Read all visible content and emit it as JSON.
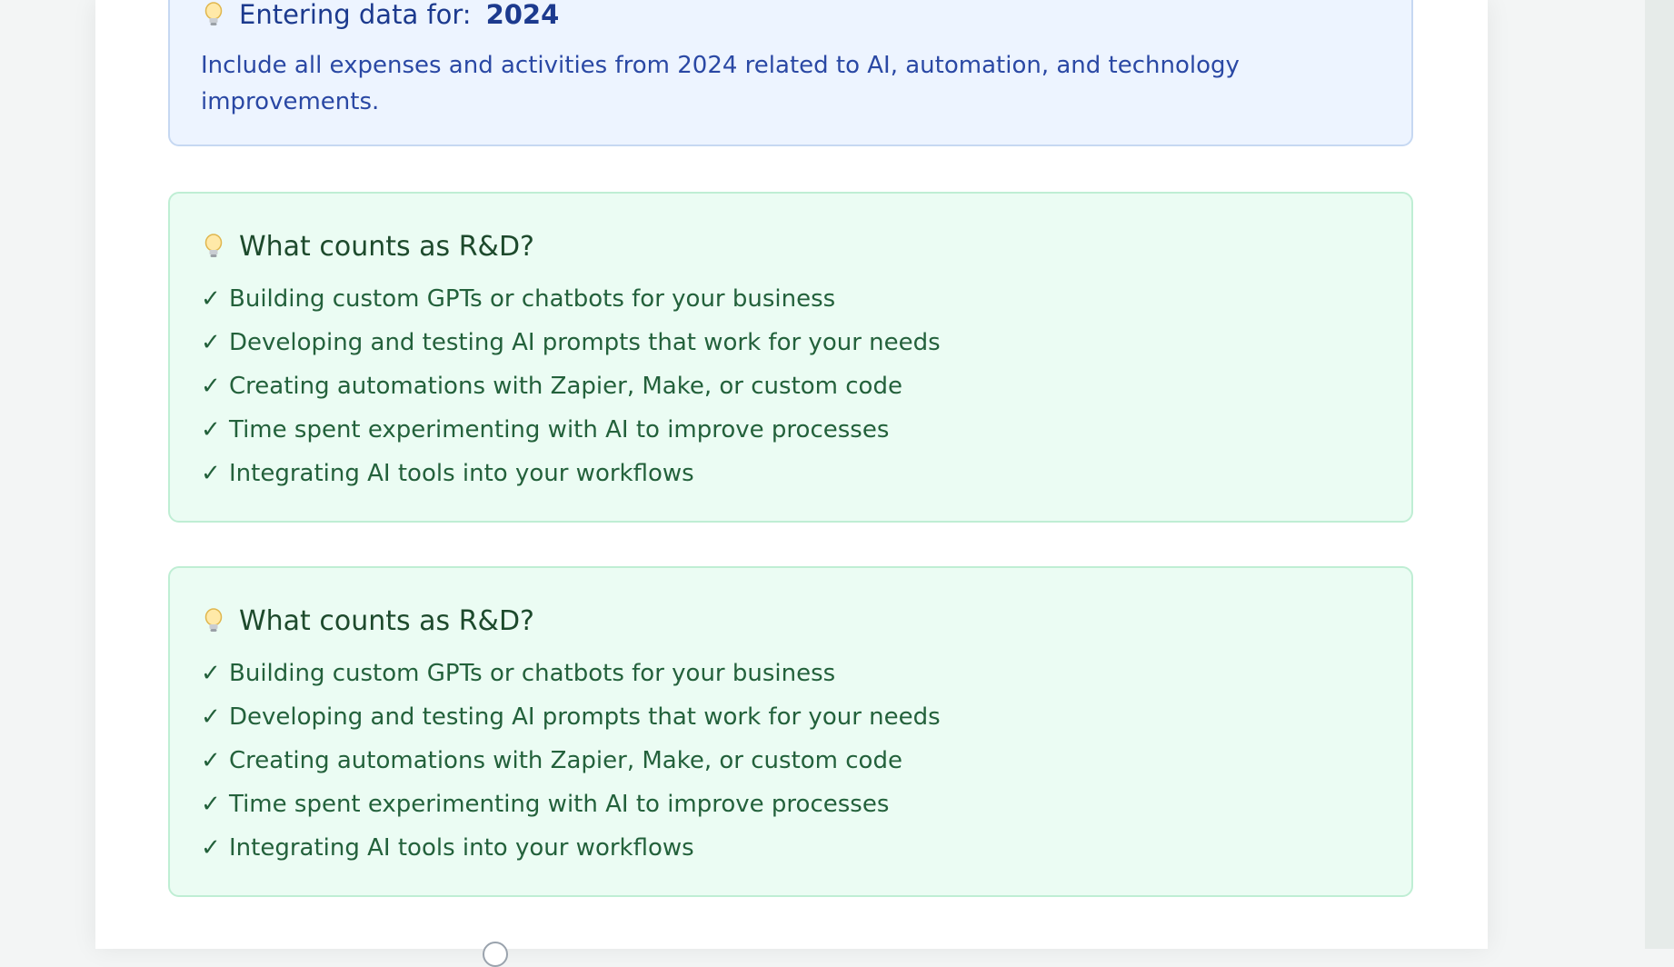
{
  "info": {
    "label": "Entering data for:",
    "year": "2024",
    "text": "Include all expenses and activities from 2024 related to AI, automation, and technology improvements.",
    "icon": "lightbulb-icon"
  },
  "rd_sections": [
    {
      "title": "What counts as R&D?",
      "icon": "lightbulb-icon",
      "items": [
        "Building custom GPTs or chatbots for your business",
        "Developing and testing AI prompts that work for your needs",
        "Creating automations with Zapier, Make, or custom code",
        "Time spent experimenting with AI to improve processes",
        "Integrating AI tools into your workflows"
      ]
    },
    {
      "title": "What counts as R&D?",
      "icon": "lightbulb-icon",
      "items": [
        "Building custom GPTs or chatbots for your business",
        "Developing and testing AI prompts that work for your needs",
        "Creating automations with Zapier, Make, or custom code",
        "Time spent experimenting with AI to improve processes",
        "Integrating AI tools into your workflows"
      ]
    }
  ],
  "check_glyph": "✓",
  "colors": {
    "info_bg": "#edf4ff",
    "info_border": "#c6d8f2",
    "info_text": "#2a48a4",
    "rd_bg": "#ebfcf3",
    "rd_border": "#bfeed4",
    "rd_text": "#23613b"
  }
}
